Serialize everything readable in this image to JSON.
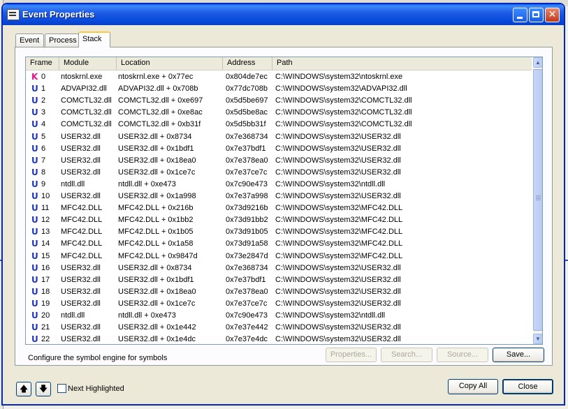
{
  "window": {
    "title": "Event Properties",
    "minimize": "minimize",
    "maximize": "maximize",
    "close": "✕"
  },
  "tabs": [
    {
      "label": "Event",
      "active": false
    },
    {
      "label": "Process",
      "active": false
    },
    {
      "label": "Stack",
      "active": true
    }
  ],
  "stack": {
    "columns": [
      "Frame",
      "Module",
      "Location",
      "Address",
      "Path"
    ],
    "rows": [
      {
        "mode": "K",
        "frame": "0",
        "module": "ntoskrnl.exe",
        "location": "ntoskrnl.exe + 0x77ec",
        "address": "0x804de7ec",
        "path": "C:\\WINDOWS\\system32\\ntoskrnl.exe"
      },
      {
        "mode": "U",
        "frame": "1",
        "module": "ADVAPI32.dll",
        "location": "ADVAPI32.dll + 0x708b",
        "address": "0x77dc708b",
        "path": "C:\\WINDOWS\\system32\\ADVAPI32.dll"
      },
      {
        "mode": "U",
        "frame": "2",
        "module": "COMCTL32.dll",
        "location": "COMCTL32.dll + 0xe697",
        "address": "0x5d5be697",
        "path": "C:\\WINDOWS\\system32\\COMCTL32.dll"
      },
      {
        "mode": "U",
        "frame": "3",
        "module": "COMCTL32.dll",
        "location": "COMCTL32.dll + 0xe8ac",
        "address": "0x5d5be8ac",
        "path": "C:\\WINDOWS\\system32\\COMCTL32.dll"
      },
      {
        "mode": "U",
        "frame": "4",
        "module": "COMCTL32.dll",
        "location": "COMCTL32.dll + 0xb31f",
        "address": "0x5d5bb31f",
        "path": "C:\\WINDOWS\\system32\\COMCTL32.dll"
      },
      {
        "mode": "U",
        "frame": "5",
        "module": "USER32.dll",
        "location": "USER32.dll + 0x8734",
        "address": "0x7e368734",
        "path": "C:\\WINDOWS\\system32\\USER32.dll"
      },
      {
        "mode": "U",
        "frame": "6",
        "module": "USER32.dll",
        "location": "USER32.dll + 0x1bdf1",
        "address": "0x7e37bdf1",
        "path": "C:\\WINDOWS\\system32\\USER32.dll"
      },
      {
        "mode": "U",
        "frame": "7",
        "module": "USER32.dll",
        "location": "USER32.dll + 0x18ea0",
        "address": "0x7e378ea0",
        "path": "C:\\WINDOWS\\system32\\USER32.dll"
      },
      {
        "mode": "U",
        "frame": "8",
        "module": "USER32.dll",
        "location": "USER32.dll + 0x1ce7c",
        "address": "0x7e37ce7c",
        "path": "C:\\WINDOWS\\system32\\USER32.dll"
      },
      {
        "mode": "U",
        "frame": "9",
        "module": "ntdll.dll",
        "location": "ntdll.dll + 0xe473",
        "address": "0x7c90e473",
        "path": "C:\\WINDOWS\\system32\\ntdll.dll"
      },
      {
        "mode": "U",
        "frame": "10",
        "module": "USER32.dll",
        "location": "USER32.dll + 0x1a998",
        "address": "0x7e37a998",
        "path": "C:\\WINDOWS\\system32\\USER32.dll"
      },
      {
        "mode": "U",
        "frame": "11",
        "module": "MFC42.DLL",
        "location": "MFC42.DLL + 0x216b",
        "address": "0x73d9216b",
        "path": "C:\\WINDOWS\\system32\\MFC42.DLL"
      },
      {
        "mode": "U",
        "frame": "12",
        "module": "MFC42.DLL",
        "location": "MFC42.DLL + 0x1bb2",
        "address": "0x73d91bb2",
        "path": "C:\\WINDOWS\\system32\\MFC42.DLL"
      },
      {
        "mode": "U",
        "frame": "13",
        "module": "MFC42.DLL",
        "location": "MFC42.DLL + 0x1b05",
        "address": "0x73d91b05",
        "path": "C:\\WINDOWS\\system32\\MFC42.DLL"
      },
      {
        "mode": "U",
        "frame": "14",
        "module": "MFC42.DLL",
        "location": "MFC42.DLL + 0x1a58",
        "address": "0x73d91a58",
        "path": "C:\\WINDOWS\\system32\\MFC42.DLL"
      },
      {
        "mode": "U",
        "frame": "15",
        "module": "MFC42.DLL",
        "location": "MFC42.DLL + 0x9847d",
        "address": "0x73e2847d",
        "path": "C:\\WINDOWS\\system32\\MFC42.DLL"
      },
      {
        "mode": "U",
        "frame": "16",
        "module": "USER32.dll",
        "location": "USER32.dll + 0x8734",
        "address": "0x7e368734",
        "path": "C:\\WINDOWS\\system32\\USER32.dll"
      },
      {
        "mode": "U",
        "frame": "17",
        "module": "USER32.dll",
        "location": "USER32.dll + 0x1bdf1",
        "address": "0x7e37bdf1",
        "path": "C:\\WINDOWS\\system32\\USER32.dll"
      },
      {
        "mode": "U",
        "frame": "18",
        "module": "USER32.dll",
        "location": "USER32.dll + 0x18ea0",
        "address": "0x7e378ea0",
        "path": "C:\\WINDOWS\\system32\\USER32.dll"
      },
      {
        "mode": "U",
        "frame": "19",
        "module": "USER32.dll",
        "location": "USER32.dll + 0x1ce7c",
        "address": "0x7e37ce7c",
        "path": "C:\\WINDOWS\\system32\\USER32.dll"
      },
      {
        "mode": "U",
        "frame": "20",
        "module": "ntdll.dll",
        "location": "ntdll.dll + 0xe473",
        "address": "0x7c90e473",
        "path": "C:\\WINDOWS\\system32\\ntdll.dll"
      },
      {
        "mode": "U",
        "frame": "21",
        "module": "USER32.dll",
        "location": "USER32.dll + 0x1e442",
        "address": "0x7e37e442",
        "path": "C:\\WINDOWS\\system32\\USER32.dll"
      },
      {
        "mode": "U",
        "frame": "22",
        "module": "USER32.dll",
        "location": "USER32.dll + 0x1e4dc",
        "address": "0x7e37e4dc",
        "path": "C:\\WINDOWS\\system32\\USER32.dll"
      }
    ]
  },
  "colors": {
    "kernel_mode": "#e0138c",
    "user_mode": "#1f35b8",
    "title_bar": "#0a5ae8"
  },
  "symbol_config": "Configure the symbol engine for symbols",
  "buttons": {
    "properties": "Properties...",
    "search": "Search...",
    "source": "Source...",
    "save": "Save...",
    "copy_all": "Copy All",
    "close": "Close",
    "up_arrow": "🡅",
    "down_arrow": "🡇"
  },
  "next_highlighted": {
    "label": "Next Highlighted",
    "checked": false
  },
  "scrollbar": {
    "up": "▲",
    "down": "▼"
  }
}
